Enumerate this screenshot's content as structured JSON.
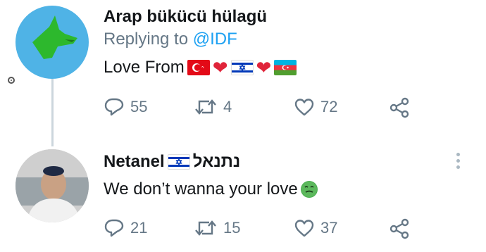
{
  "tweet1": {
    "author": "Arap bükücü hülagü",
    "replying_prefix": "Replying to ",
    "replying_handle": "@IDF",
    "text": "Love From",
    "emojis": [
      "turkey-flag",
      "red-heart",
      "israel-flag",
      "red-heart",
      "azerbaijan-flag"
    ],
    "reply_count": "55",
    "retweet_count": "4",
    "like_count": "72"
  },
  "tweet2": {
    "author": "Netanel",
    "author_suffix": "נתנאל",
    "text": "We don’t wanna your love",
    "emoji": "nauseated-face",
    "reply_count": "21",
    "retweet_count": "15",
    "like_count": "37"
  },
  "colors": {
    "handle": "#1da1f2",
    "muted": "#657786",
    "avatar1_bg": "#4fb3e6",
    "wolf": "#2db82d"
  }
}
